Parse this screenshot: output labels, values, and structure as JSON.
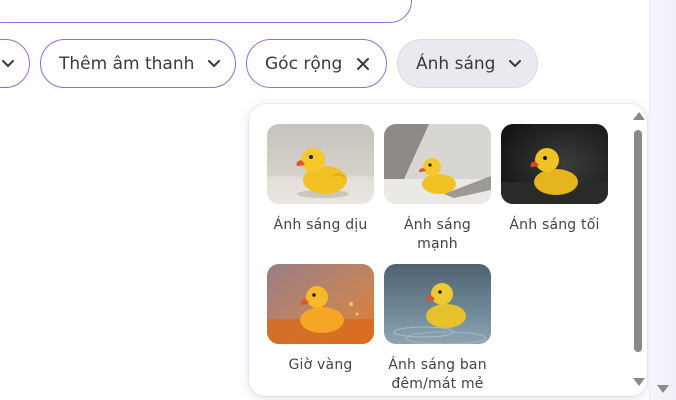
{
  "chips": [
    {
      "label": "",
      "icon": "chevron-down-icon"
    },
    {
      "label": "Thêm âm thanh",
      "icon": "chevron-down-icon"
    },
    {
      "label": "Góc rộng",
      "icon": "close-icon"
    },
    {
      "label": "Ánh sáng",
      "icon": "chevron-down-icon",
      "selected": true
    }
  ],
  "lighting_menu": {
    "options": [
      {
        "label": "Ánh sáng dịu",
        "image": "rubber duck in soft light"
      },
      {
        "label": "Ánh sáng mạnh",
        "image": "rubber duck in hard light"
      },
      {
        "label": "Ánh sáng tối",
        "image": "rubber duck in low light"
      },
      {
        "label": "Giờ vàng",
        "image": "rubber duck at golden hour"
      },
      {
        "label": "Ánh sáng ban đêm/mát mẻ",
        "image": "rubber duck in cool night light"
      }
    ]
  },
  "colors": {
    "accent": "#9b6ad6",
    "selected_chip_bg": "#ebe9ef",
    "duck_yellow": "#f2c224",
    "beak_orange": "#e8542a"
  }
}
